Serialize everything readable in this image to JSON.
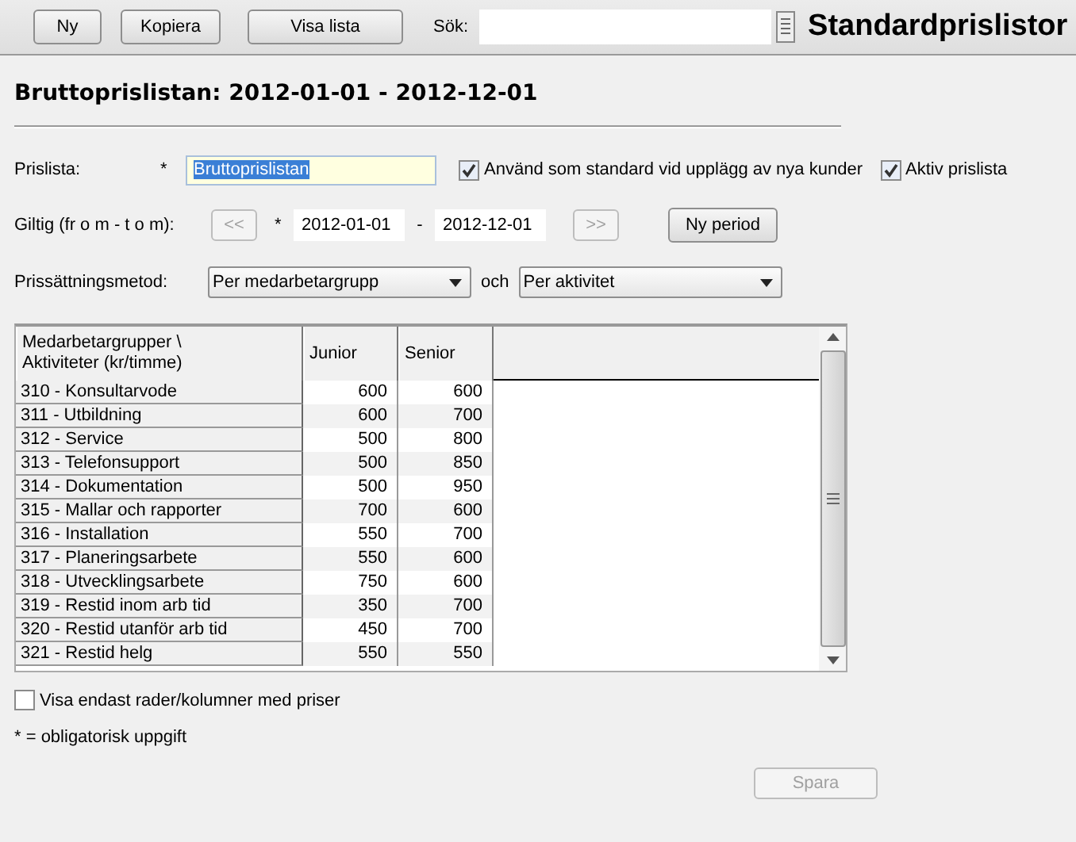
{
  "toolbar": {
    "buttons": [
      {
        "label": "Ny",
        "disabled": false
      },
      {
        "label": "Kopiera",
        "disabled": false
      },
      {
        "label": "Visa lista",
        "disabled": false
      }
    ],
    "search_label": "Sök:",
    "title": "Standardprislistor"
  },
  "heading": "Bruttoprislistan: 2012-01-01 - 2012-12-01",
  "price_list": {
    "label": "Prislista:",
    "required_mark": "*",
    "value": "Bruttoprislistan",
    "text_selected": true,
    "checkboxes": [
      {
        "label": "Använd som standard vid upplägg av nya kunder",
        "checked": true
      },
      {
        "label": "Aktiv prislista",
        "checked": true
      }
    ]
  },
  "period": {
    "label": "Giltig (fr o m - t o m):",
    "prev": {
      "label": "<<",
      "disabled": true
    },
    "required_mark": "*",
    "from": "2012-01-01",
    "separator": "-",
    "to": "2012-12-01",
    "next": {
      "label": ">>",
      "disabled": true
    },
    "new_period": {
      "label": "Ny period",
      "disabled": false
    }
  },
  "pricing": {
    "label": "Prissättningsmetod:",
    "method_1": "Per medarbetargrupp",
    "conjunction": "och",
    "method_2": "Per aktivitet"
  },
  "table": {
    "columns": [
      "Medarbetargrupper \\ Aktiviteter (kr/timme)",
      "Junior",
      "Senior"
    ],
    "rows": [
      [
        "310 - Konsultarvode",
        "600",
        "600"
      ],
      [
        "311 - Utbildning",
        "600",
        "700"
      ],
      [
        "312 - Service",
        "500",
        "800"
      ],
      [
        "313 - Telefonsupport",
        "500",
        "850"
      ],
      [
        "314 - Dokumentation",
        "500",
        "950"
      ],
      [
        "315 - Mallar och rapporter",
        "700",
        "600"
      ],
      [
        "316 - Installation",
        "550",
        "700"
      ],
      [
        "317 - Planeringsarbete",
        "550",
        "600"
      ],
      [
        "318 - Utvecklingsarbete",
        "750",
        "600"
      ],
      [
        "319 - Restid inom arb tid",
        "350",
        "700"
      ],
      [
        "320 - Restid utanför arb tid",
        "450",
        "700"
      ],
      [
        "321 - Restid helg",
        "550",
        "550"
      ]
    ]
  },
  "filter": {
    "label": "Visa endast rader/kolumner med priser",
    "checked": false
  },
  "note": "* = obligatorisk uppgift",
  "save": {
    "label": "Spara",
    "disabled": true
  }
}
